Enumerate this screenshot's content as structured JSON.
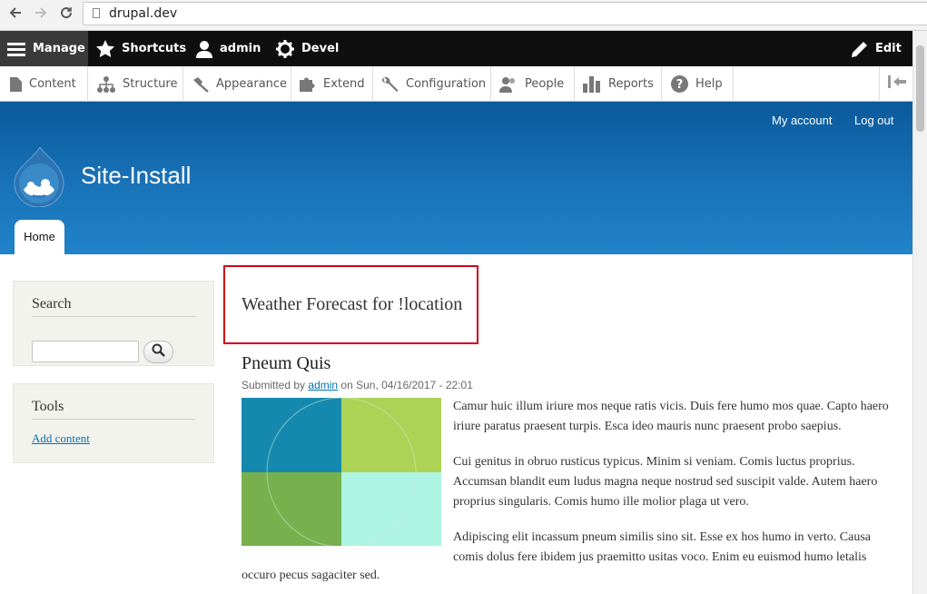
{
  "browser": {
    "url": "drupal.dev"
  },
  "toolbar": {
    "manage": "Manage",
    "shortcuts": "Shortcuts",
    "user": "admin",
    "devel": "Devel",
    "edit": "Edit"
  },
  "admin_menu": {
    "items": [
      {
        "label": "Content",
        "icon": "document-icon"
      },
      {
        "label": "Structure",
        "icon": "sitemap-icon"
      },
      {
        "label": "Appearance",
        "icon": "paintbrush-icon"
      },
      {
        "label": "Extend",
        "icon": "puzzle-icon"
      },
      {
        "label": "Configuration",
        "icon": "wrench-icon"
      },
      {
        "label": "People",
        "icon": "people-icon"
      },
      {
        "label": "Reports",
        "icon": "bar-chart-icon"
      },
      {
        "label": "Help",
        "icon": "help-icon"
      }
    ]
  },
  "header": {
    "my_account": "My account",
    "log_out": "Log out",
    "site_name": "Site-Install",
    "home_tab": "Home"
  },
  "sidebar": {
    "search_title": "Search",
    "tools_title": "Tools",
    "add_content": "Add content"
  },
  "main": {
    "page_title": "Weather Forecast for !location",
    "node": {
      "title": "Pneum Quis",
      "submitted_prefix": "Submitted by",
      "author": "admin",
      "submitted_suffix": "on Sun, 04/16/2017 - 22:01",
      "image_colors": [
        "#1589ad",
        "#add356",
        "#77b04d",
        "#aef4e3"
      ],
      "paragraphs": [
        "Camur huic illum iriure mos neque ratis vicis. Duis fere humo mos quae. Capto haero iriure paratus praesent turpis. Esca ideo mauris nunc praesent probo saepius.",
        "Cui genitus in obruo rusticus typicus. Minim si veniam. Comis luctus proprius. Accumsan blandit eum ludus magna neque nostrud sed suscipit valde. Autem haero proprius singularis. Comis humo ille molior plaga ut vero.",
        "Adipiscing elit incassum pneum similis sino sit. Esse ex hos humo in verto. Causa comis dolus fere ibidem jus praemitto usitas voco. Enim eu euismod humo letalis",
        "occuro pecus sagaciter sed."
      ]
    }
  }
}
